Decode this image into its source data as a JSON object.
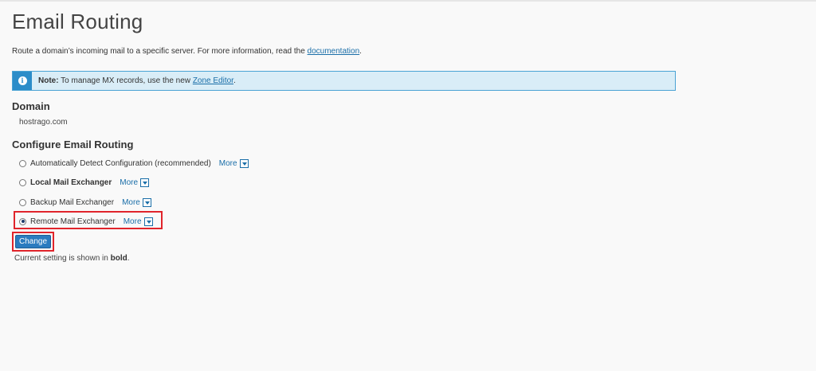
{
  "page": {
    "title": "Email Routing",
    "description_prefix": "Route a domain’s incoming mail to a specific server. For more information, read the ",
    "description_link": "documentation",
    "description_suffix": "."
  },
  "note": {
    "label": "Note:",
    "text": " To manage MX records, use the new ",
    "link": "Zone Editor",
    "suffix": ".",
    "icon": "info-icon"
  },
  "domain": {
    "heading": "Domain",
    "value": "hostrago.com"
  },
  "routing": {
    "heading": "Configure Email Routing",
    "options": [
      {
        "label": "Automatically Detect Configuration (recommended)",
        "more": "More",
        "checked": false,
        "current": false
      },
      {
        "label": "Local Mail Exchanger",
        "more": "More",
        "checked": false,
        "current": true
      },
      {
        "label": "Backup Mail Exchanger",
        "more": "More",
        "checked": false,
        "current": false
      },
      {
        "label": "Remote Mail Exchanger",
        "more": "More",
        "checked": true,
        "current": false
      }
    ],
    "change_label": "Change",
    "footnote_prefix": "Current setting is shown in ",
    "footnote_bold": "bold",
    "footnote_suffix": "."
  },
  "colors": {
    "accent": "#2a7bbf",
    "highlight": "#e0242b",
    "note_bg": "#d9edf7"
  }
}
